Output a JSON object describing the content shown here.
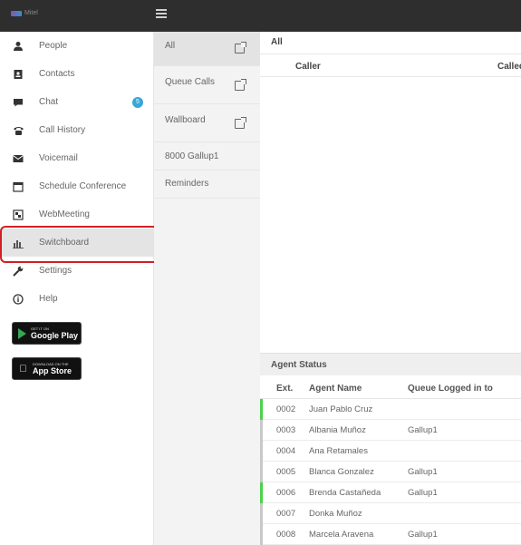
{
  "app": {
    "logo_text": "Mitel"
  },
  "sidebar": {
    "items": [
      {
        "id": "people",
        "label": "People",
        "icon": "person-icon"
      },
      {
        "id": "contacts",
        "label": "Contacts",
        "icon": "address-book-icon"
      },
      {
        "id": "chat",
        "label": "Chat",
        "icon": "chat-bubble-icon",
        "badge": "5"
      },
      {
        "id": "call-history",
        "label": "Call History",
        "icon": "phone-icon"
      },
      {
        "id": "voicemail",
        "label": "Voicemail",
        "icon": "envelope-icon"
      },
      {
        "id": "schedule-conference",
        "label": "Schedule Conference",
        "icon": "calendar-icon"
      },
      {
        "id": "webmeeting",
        "label": "WebMeeting",
        "icon": "webmeeting-icon"
      },
      {
        "id": "switchboard",
        "label": "Switchboard",
        "icon": "bar-chart-icon",
        "active": true
      },
      {
        "id": "settings",
        "label": "Settings",
        "icon": "wrench-icon"
      },
      {
        "id": "help",
        "label": "Help",
        "icon": "info-icon"
      }
    ],
    "google_play": {
      "small": "Get it on",
      "big": "Google Play"
    },
    "app_store": {
      "small": "Download on the",
      "big": "App Store"
    }
  },
  "subnav": {
    "items": [
      {
        "label": "All",
        "external": true,
        "active": true
      },
      {
        "label": "Queue Calls",
        "external": true
      },
      {
        "label": "Wallboard",
        "external": true
      },
      {
        "label": "8000 Gallup1",
        "external": false
      },
      {
        "label": "Reminders",
        "external": false
      }
    ]
  },
  "main": {
    "title": "All",
    "calls_columns": [
      "Caller",
      "Called"
    ],
    "agent_status": {
      "title": "Agent Status",
      "columns": [
        "Ext.",
        "Agent Name",
        "Queue Logged in to"
      ],
      "rows": [
        {
          "ext": "0002",
          "name": "Juan Pablo Cruz",
          "queue": "",
          "online": true
        },
        {
          "ext": "0003",
          "name": "Albania Muñoz",
          "queue": "Gallup1",
          "online": false
        },
        {
          "ext": "0004",
          "name": "Ana Retamales",
          "queue": "",
          "online": false
        },
        {
          "ext": "0005",
          "name": "Blanca Gonzalez",
          "queue": "Gallup1",
          "online": false
        },
        {
          "ext": "0006",
          "name": "Brenda Castañeda",
          "queue": "Gallup1",
          "online": true
        },
        {
          "ext": "0007",
          "name": "Donka Muñoz",
          "queue": "",
          "online": false
        },
        {
          "ext": "0008",
          "name": "Marcela Aravena",
          "queue": "Gallup1",
          "online": false
        }
      ]
    }
  },
  "colors": {
    "topbar": "#2e2e2e",
    "highlight": "#d21f26",
    "badge": "#3aa6d6",
    "online": "#4cd14c"
  }
}
